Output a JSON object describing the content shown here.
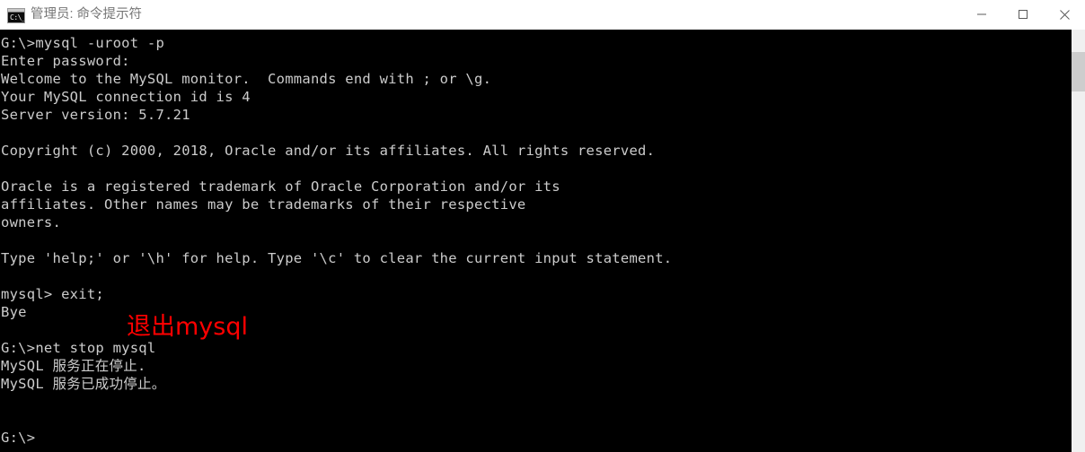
{
  "window": {
    "title": "管理员: 命令提示符",
    "icon_name": "cmd-icon",
    "icon_glyph": "C:\\_",
    "colors": {
      "titlebar_bg": "#ffffff",
      "title_text": "#767676",
      "console_bg": "#000000",
      "console_text": "#cccccc",
      "annotation": "#ff0000",
      "scroll_track": "#f0f0f0",
      "scroll_thumb": "#cdcdcd"
    },
    "controls": {
      "minimize_label": "最小化",
      "maximize_label": "最大化",
      "close_label": "关闭"
    }
  },
  "console": {
    "lines": [
      "G:\\>mysql -uroot -p",
      "Enter password:",
      "Welcome to the MySQL monitor.  Commands end with ; or \\g.",
      "Your MySQL connection id is 4",
      "Server version: 5.7.21",
      "",
      "Copyright (c) 2000, 2018, Oracle and/or its affiliates. All rights reserved.",
      "",
      "Oracle is a registered trademark of Oracle Corporation and/or its",
      "affiliates. Other names may be trademarks of their respective",
      "owners.",
      "",
      "Type 'help;' or '\\h' for help. Type '\\c' to clear the current input statement.",
      "",
      "mysql> exit;",
      "Bye",
      "",
      "G:\\>net stop mysql",
      "MySQL 服务正在停止.",
      "MySQL 服务已成功停止。",
      "",
      "",
      "G:\\>"
    ],
    "text": "G:\\>mysql -uroot -p\nEnter password:\nWelcome to the MySQL monitor.  Commands end with ; or \\g.\nYour MySQL connection id is 4\nServer version: 5.7.21\n\nCopyright (c) 2000, 2018, Oracle and/or its affiliates. All rights reserved.\n\nOracle is a registered trademark of Oracle Corporation and/or its\naffiliates. Other names may be trademarks of their respective\nowners.\n\nType 'help;' or '\\h' for help. Type '\\c' to clear the current input statement.\n\nmysql> exit;\nBye\n\nG:\\>net stop mysql\nMySQL 服务正在停止.\nMySQL 服务已成功停止。\n\n\nG:\\>"
  },
  "annotation": {
    "text": "退出mysql"
  },
  "scrollbar": {
    "thumb_position_percent": 5
  }
}
